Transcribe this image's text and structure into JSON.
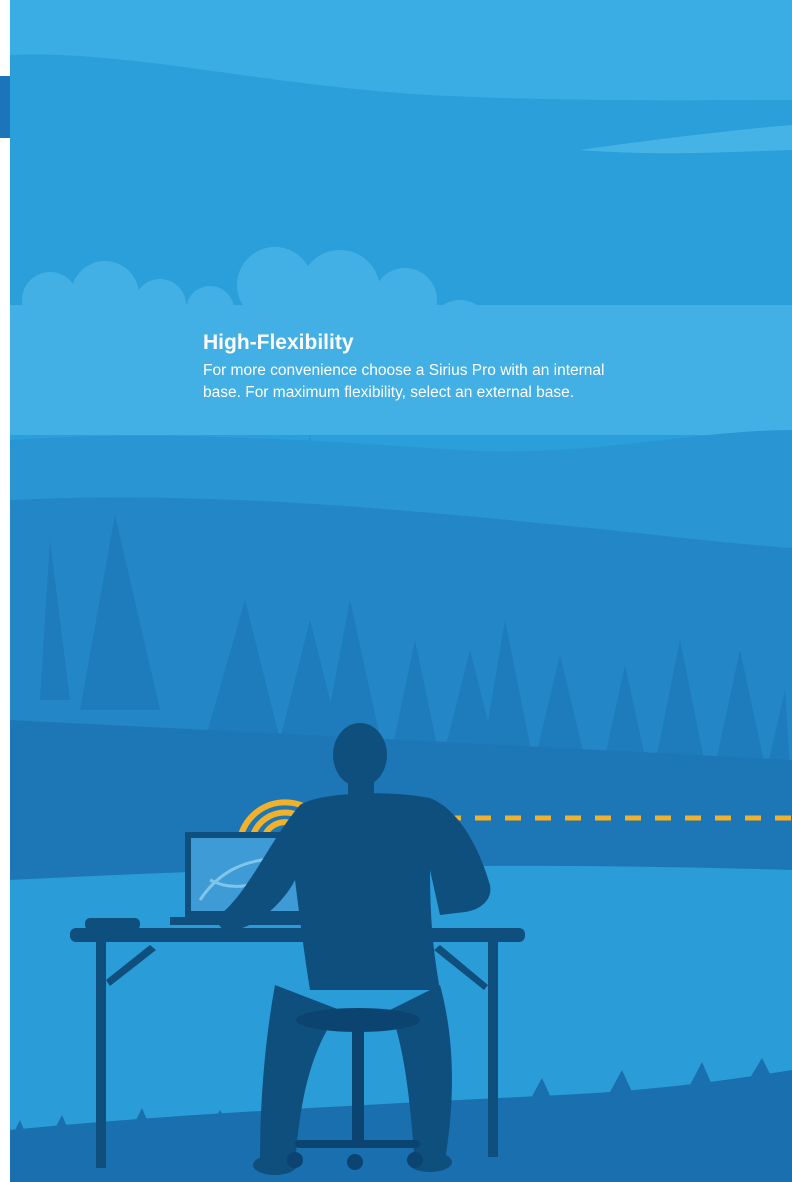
{
  "content": {
    "headline": "High-Flexibility",
    "body_line_1": "For more convenience choose a Sirius Pro with an internal",
    "body_line_2": "base. For maximum flexibility, select an external base."
  },
  "colors": {
    "sky": "#3aaee4",
    "sky_band": "#2b9fda",
    "far_hills": "#2a8fcf",
    "forest": "#1f79b8",
    "meadow": "#2a9cd8",
    "foreground_grass": "#1a6fae",
    "silhouette": "#0f4f7e",
    "signal": "#f2b12b",
    "edge_tab": "#1b75bb"
  },
  "icons": {
    "person": "person-silhouette-icon",
    "laptop": "laptop-icon",
    "signal": "signal-waves-icon",
    "link": "dashed-signal-line-icon"
  }
}
